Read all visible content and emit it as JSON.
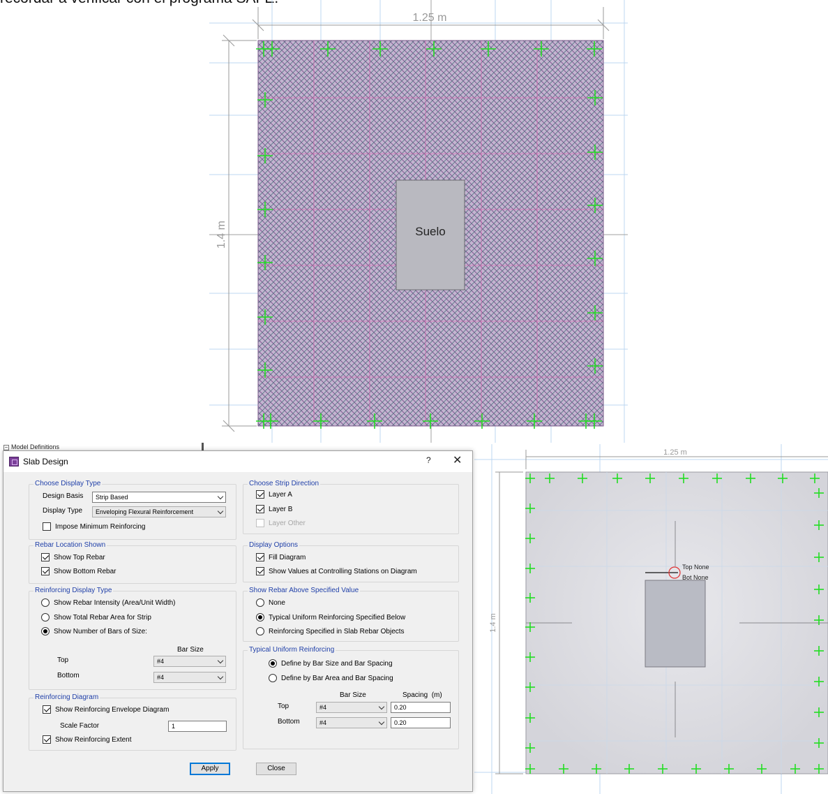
{
  "page": {
    "top_text": "recordar a verificar con el programa SAFE.",
    "tree_label": "Model Definitions"
  },
  "plan_top": {
    "width_label": "1.25 m",
    "height_label": "1.4 m",
    "column_label": "Suelo"
  },
  "plan_bottom": {
    "width_label": "1.25 m",
    "height_label": "1.4 m",
    "top_label": "Top None",
    "bot_label": "Bot None"
  },
  "dialog": {
    "title": "Slab Design",
    "help_label": "?",
    "close_symbol": "✕",
    "display_type": {
      "title": "Choose Display Type",
      "design_basis_label": "Design Basis",
      "design_basis_value": "Strip Based",
      "display_type_label": "Display Type",
      "display_type_value": "Enveloping Flexural Reinforcement",
      "impose_min_label": "Impose Minimum Reinforcing"
    },
    "strip_direction": {
      "title": "Choose Strip Direction",
      "layer_a": "Layer A",
      "layer_b": "Layer B",
      "layer_other": "Layer Other"
    },
    "rebar_location": {
      "title": "Rebar Location Shown",
      "top": "Show Top Rebar",
      "bottom": "Show Bottom Rebar"
    },
    "display_options": {
      "title": "Display Options",
      "fill": "Fill Diagram",
      "values": "Show Values at Controlling Stations on Diagram"
    },
    "reinforcing_display": {
      "title": "Reinforcing Display Type",
      "intensity": "Show Rebar Intensity (Area/Unit Width)",
      "total_area": "Show Total Rebar Area for Strip",
      "num_bars": "Show Number of Bars of Size:",
      "bar_size_header": "Bar Size",
      "top_label": "Top",
      "top_value": "#4",
      "bottom_label": "Bottom",
      "bottom_value": "#4"
    },
    "rebar_above": {
      "title": "Show Rebar Above Specified Value",
      "none": "None",
      "typical": "Typical Uniform Reinforcing Specified Below",
      "slab_objects": "Reinforcing Specified in Slab Rebar Objects"
    },
    "typical_uniform": {
      "title": "Typical Uniform Reinforcing",
      "by_size": "Define by Bar Size and Bar Spacing",
      "by_area": "Define by Bar Area and Bar Spacing",
      "bar_size_header": "Bar Size",
      "spacing_header": "Spacing",
      "spacing_unit": "(m)",
      "top_label": "Top",
      "top_size": "#4",
      "top_spacing": "0.20",
      "bottom_label": "Bottom",
      "bottom_size": "#4",
      "bottom_spacing": "0.20"
    },
    "reinforcing_diagram": {
      "title": "Reinforcing Diagram",
      "envelope": "Show Reinforcing Envelope Diagram",
      "scale_label": "Scale Factor",
      "scale_value": "1",
      "extent": "Show Reinforcing Extent"
    },
    "apply_label": "Apply",
    "close_label": "Close"
  },
  "colors": {
    "slab_fill": "#b7a4c6",
    "grid_line": "#bcd7f0",
    "marker": "#22dd22",
    "accent_text": "#1f3fa8"
  }
}
